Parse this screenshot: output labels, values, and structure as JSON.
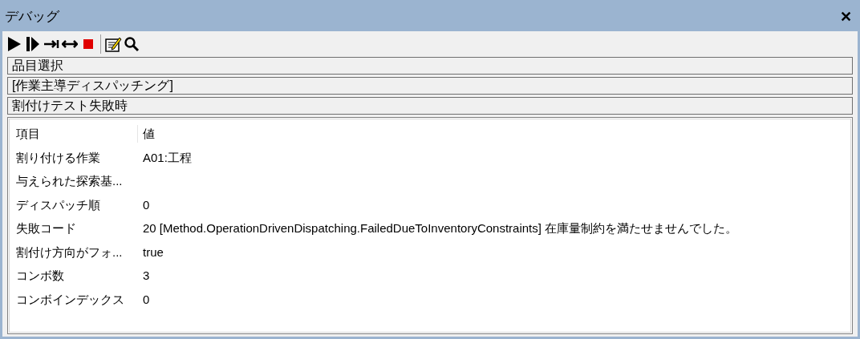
{
  "window": {
    "title": "デバッグ",
    "close": "✕"
  },
  "info_lines": [
    "品目選択",
    "[作業主導ディスパッチング]",
    "割付けテスト失敗時"
  ],
  "table": {
    "columns": [
      "項目",
      "値"
    ],
    "rows": [
      [
        "割り付ける作業",
        "A01:工程"
      ],
      [
        "与えられた探索基...",
        ""
      ],
      [
        "ディスパッチ順",
        "0"
      ],
      [
        "失敗コード",
        "20 [Method.OperationDrivenDispatching.FailedDueToInventoryConstraints] 在庫量制約を満たせませんでした。"
      ],
      [
        "割付け方向がフォ...",
        "true"
      ],
      [
        "コンボ数",
        "3"
      ],
      [
        "コンボインデックス",
        "0"
      ]
    ]
  }
}
